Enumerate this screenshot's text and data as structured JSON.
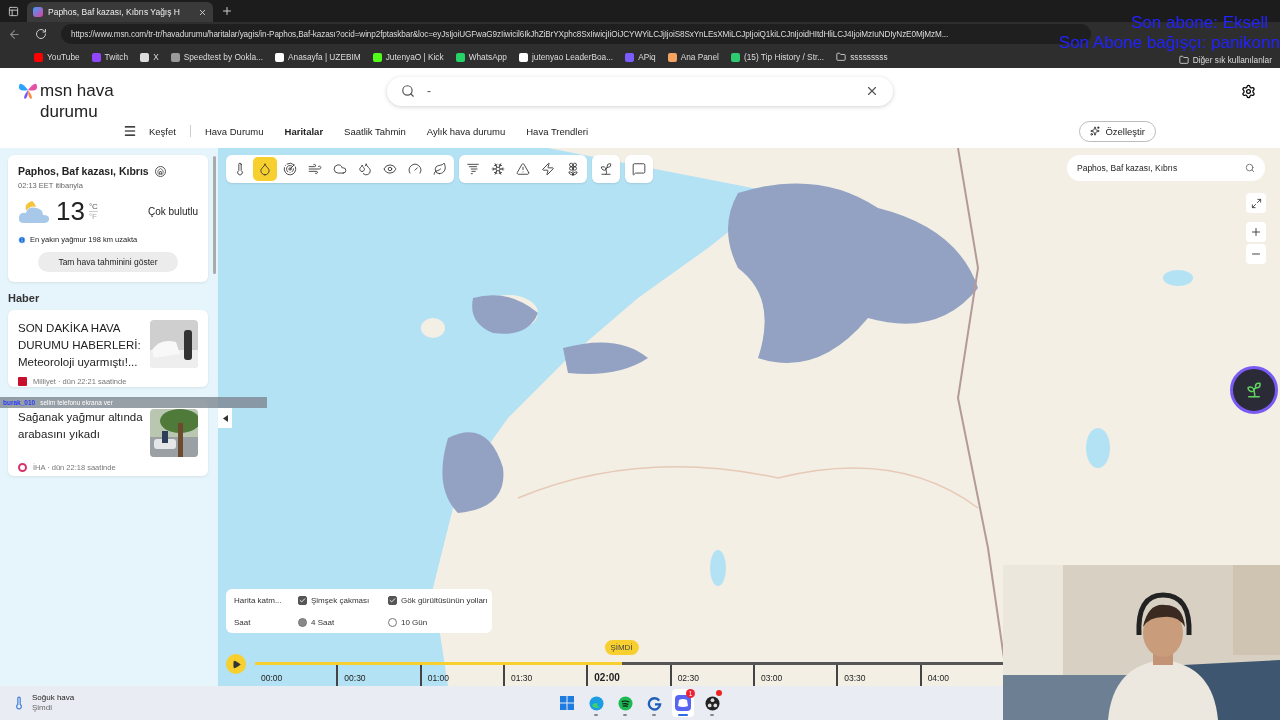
{
  "browser": {
    "tab_title": "Paphos, Baf kazası, Kıbrıs Yağış H",
    "url": "https://www.msn.com/tr-tr/havadurumu/haritalar/yagis/in-Paphos,Baf-kazası?ocid=winp2fptaskbar&loc=eyJsIjoiUGFwaG9zIiwicil6IkJhZiBrYXphc8SxIiwicjIiOiJCYWYiLCJjIjoiS8SxYnLEsXMiLCJpIjoiQ1kiLCJnIjoidHItdHliLCJ4IjoiMzIuNDIyNzE0MjMzM...",
    "bookmarks": [
      "YouTube",
      "Twitch",
      "X",
      "Speedtest by Ookla...",
      "Anasayfa | UZEBIM",
      "JutenyaO | Kick",
      "WhatsApp",
      "jutenyao LeaderBoa...",
      "APiq",
      "Ana Panel",
      "(15) Tip History / Str...",
      "sssssssss"
    ],
    "bookmarks_overflow": "Diğer sık kullanılanlar"
  },
  "stream_overlay": [
    "Son abone: Eksell",
    "Son Abone bağışçı: panikonn"
  ],
  "header": {
    "logo": "msn hava durumu",
    "search_value": "-",
    "nav": [
      {
        "label": "Keşfet",
        "selected": false
      },
      {
        "label": "Hava Durumu",
        "selected": false
      },
      {
        "label": "Haritalar",
        "selected": true
      },
      {
        "label": "Saatlik Tahmin",
        "selected": false
      },
      {
        "label": "Aylık hava durumu",
        "selected": false
      },
      {
        "label": "Hava Trendleri",
        "selected": false
      }
    ],
    "customize": "Özelleştir"
  },
  "current": {
    "location": "Paphos, Baf kazası, Kıbrıs",
    "updated": "02:13 EET itibanyla",
    "temperature": "13",
    "unit_c": "°C",
    "unit_f": "°F",
    "condition": "Çok bulutlu",
    "rain_note": "En yakın yağmur 198 km uzakta",
    "forecast_button": "Tam hava tahminini göster"
  },
  "news_heading": "Haber",
  "news": [
    {
      "headline": "SON DAKİKA HAVA DURUMU HABERLERİ: Meteoroloji uyarmıştı!...",
      "source": "Milliyet · dün 22:21 saatinde",
      "kind": "square",
      "color": "#c8102e"
    },
    {
      "headline": "Sağanak yağmur altında arabasını yıkadı",
      "source": "İHA · dün 22:18 saatinde",
      "kind": "ring",
      "color": "#d6336c"
    }
  ],
  "chat": {
    "user": "burak_010",
    "message": "selim telefonu ekrana ver"
  },
  "map": {
    "layer_groups": [
      {
        "layers": [
          {
            "selected": false
          },
          {
            "selected": true
          },
          {
            "selected": false
          },
          {
            "selected": false
          },
          {
            "selected": false
          },
          {
            "selected": false
          },
          {
            "selected": false
          },
          {
            "selected": false
          },
          {
            "selected": false
          }
        ]
      },
      {
        "layers": [
          {
            "selected": false
          },
          {
            "selected": false
          },
          {
            "selected": false
          },
          {
            "selected": false
          },
          {
            "selected": false
          }
        ]
      },
      {
        "layers": [
          {
            "selected": false
          }
        ]
      },
      {
        "layers": [
          {
            "selected": false
          }
        ]
      }
    ],
    "search_value": "Paphos, Baf kazası, Kıbrıs",
    "layer_label": "Harita katm...",
    "overlays": [
      {
        "label": "Şimşek çakması",
        "checked": true
      },
      {
        "label": "Gök gürültüsünün yolları",
        "checked": true
      }
    ],
    "range_label": "Saat",
    "ranges": [
      {
        "label": "4 Saat",
        "selected": true
      },
      {
        "label": "10 Gün",
        "selected": false
      }
    ],
    "timeline": {
      "now": "ŞİMDİ",
      "level": 0.49,
      "times": [
        {
          "label": "00:00",
          "selected": false
        },
        {
          "label": "00:30",
          "selected": false
        },
        {
          "label": "01:00",
          "selected": false
        },
        {
          "label": "01:30",
          "selected": false
        },
        {
          "label": "02:00",
          "selected": true
        },
        {
          "label": "02:30",
          "selected": false
        },
        {
          "label": "03:00",
          "selected": false
        },
        {
          "label": "03:30",
          "selected": false
        },
        {
          "label": "04:00",
          "selected": false
        }
      ]
    }
  },
  "taskbar": {
    "weather_title": "Soğuk hava",
    "weather_sub": "Şimdi",
    "apps": [
      {
        "running": false,
        "active": false,
        "alert": false
      },
      {
        "running": true,
        "active": false,
        "alert": false
      },
      {
        "running": true,
        "active": false,
        "alert": false
      },
      {
        "running": true,
        "active": false,
        "alert": false
      },
      {
        "running": true,
        "active": true,
        "badge": "1",
        "alert": false
      },
      {
        "running": true,
        "active": false,
        "alert": true
      }
    ]
  }
}
